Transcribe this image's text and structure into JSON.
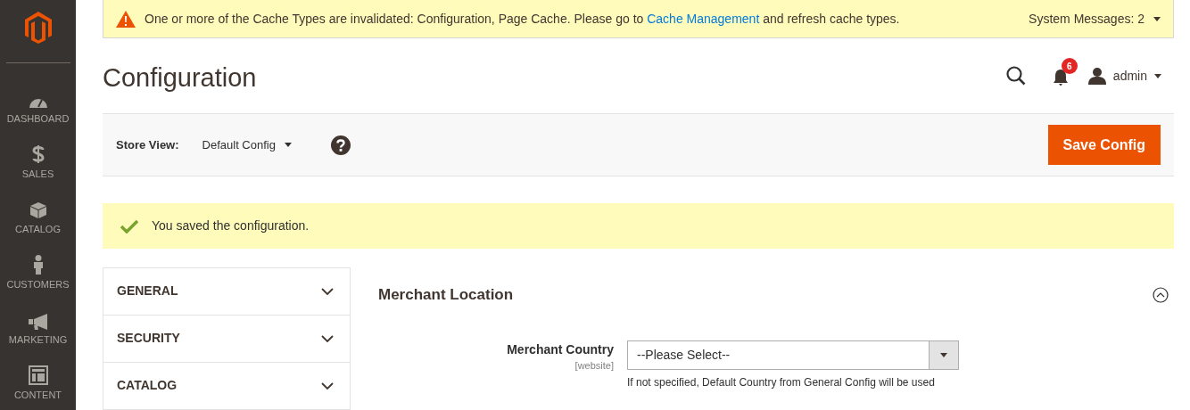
{
  "sidebar": {
    "items": [
      {
        "label": "DASHBOARD",
        "kind": "gauge"
      },
      {
        "label": "SALES",
        "kind": "dollar"
      },
      {
        "label": "CATALOG",
        "kind": "box"
      },
      {
        "label": "CUSTOMERS",
        "kind": "person"
      },
      {
        "label": "MARKETING",
        "kind": "megaphone"
      },
      {
        "label": "CONTENT",
        "kind": "layout"
      }
    ]
  },
  "system_banner": {
    "text_before": "One or more of the Cache Types are invalidated: Configuration, Page Cache. Please go to",
    "link": "Cache Management",
    "text_after": "and refresh cache types.",
    "messages": "System Messages: 2"
  },
  "header": {
    "title": "Configuration",
    "notifications": "6",
    "user": "admin"
  },
  "store_bar": {
    "label": "Store View:",
    "value": "Default Config",
    "button": "Save Config"
  },
  "success_message": "You saved the configuration.",
  "config_nav": [
    {
      "label": "GENERAL",
      "expanded": false
    },
    {
      "label": "SECURITY",
      "expanded": false
    },
    {
      "label": "CATALOG",
      "expanded": false
    }
  ],
  "section": {
    "title": "Merchant Location",
    "expanded": true,
    "fields": [
      {
        "label": "Merchant Country",
        "scope": "[website]",
        "placeholder": "--Please Select--",
        "note": "If not specified, Default Country from General Config will be used"
      }
    ]
  }
}
